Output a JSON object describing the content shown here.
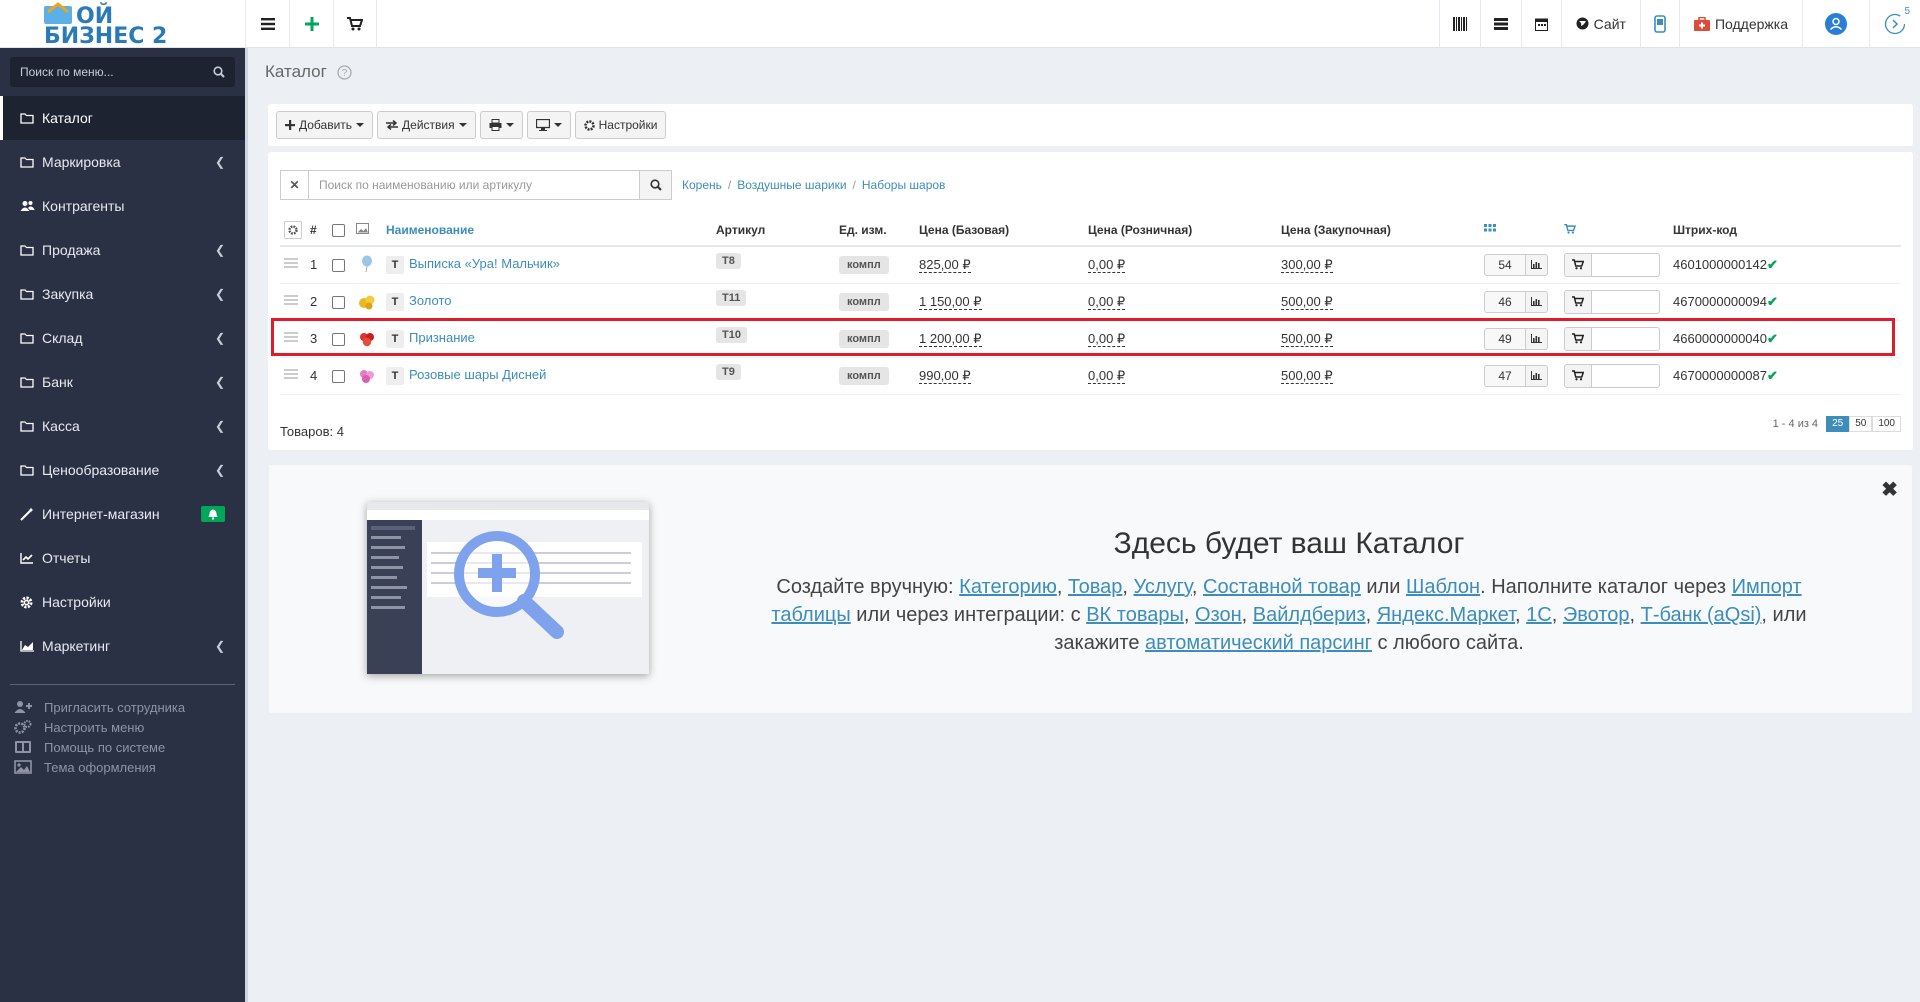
{
  "app": {
    "logo_line1": "МОЙ",
    "logo_line2": "БИЗНЕС 2"
  },
  "topbar": {
    "site_label": "Сайт",
    "support_label": "Поддержка",
    "notif_count": "5"
  },
  "sidebar": {
    "search_placeholder": "Поиск по меню...",
    "items": [
      {
        "label": "Каталог",
        "icon": "folder-icon"
      },
      {
        "label": "Маркировка",
        "icon": "folder-icon"
      },
      {
        "label": "Контрагенты",
        "icon": "users-icon"
      },
      {
        "label": "Продажа",
        "icon": "folder-icon"
      },
      {
        "label": "Закупка",
        "icon": "folder-icon"
      },
      {
        "label": "Склад",
        "icon": "folder-icon"
      },
      {
        "label": "Банк",
        "icon": "folder-icon"
      },
      {
        "label": "Касса",
        "icon": "folder-icon"
      },
      {
        "label": "Ценообразование",
        "icon": "folder-icon"
      },
      {
        "label": "Интернет-магазин",
        "icon": "magic-icon"
      },
      {
        "label": "Отчеты",
        "icon": "chart-icon"
      },
      {
        "label": "Настройки",
        "icon": "gear-icon"
      },
      {
        "label": "Маркетинг",
        "icon": "area-chart-icon"
      }
    ],
    "extras": [
      {
        "label": "Пригласить сотрудника"
      },
      {
        "label": "Настроить меню"
      },
      {
        "label": "Помощь по системе"
      },
      {
        "label": "Тема оформления"
      }
    ]
  },
  "page": {
    "title": "Каталог"
  },
  "toolbar": {
    "add_label": "Добавить",
    "actions_label": "Действия",
    "settings_label": "Настройки"
  },
  "catalog": {
    "search_placeholder": "Поиск по наименованию или артикулу",
    "breadcrumb": [
      "Корень",
      "Воздушные шарики",
      "Наборы шаров"
    ],
    "columns": {
      "num": "#",
      "name": "Наименование",
      "article": "Артикул",
      "unit": "Ед. изм.",
      "price_base": "Цена (Базовая)",
      "price_retail": "Цена (Розничная)",
      "price_purchase": "Цена (Закупочная)",
      "barcode": "Штрих-код"
    },
    "rows": [
      {
        "num": "1",
        "type": "Т",
        "name": "Выписка «Ура! Мальчик»",
        "article": "Т8",
        "unit": "компл",
        "price_base": "825,00 ₽",
        "price_retail": "0,00 ₽",
        "price_purchase": "300,00 ₽",
        "stock": "54",
        "barcode": "4601000000142"
      },
      {
        "num": "2",
        "type": "Т",
        "name": "Золото",
        "article": "Т11",
        "unit": "компл",
        "price_base": "1 150,00 ₽",
        "price_retail": "0,00 ₽",
        "price_purchase": "500,00 ₽",
        "stock": "46",
        "barcode": "4670000000094"
      },
      {
        "num": "3",
        "type": "Т",
        "name": "Признание",
        "article": "Т10",
        "unit": "компл",
        "price_base": "1 200,00 ₽",
        "price_retail": "0,00 ₽",
        "price_purchase": "500,00 ₽",
        "stock": "49",
        "barcode": "4660000000040"
      },
      {
        "num": "4",
        "type": "Т",
        "name": "Розовые шары Дисней",
        "article": "Т9",
        "unit": "компл",
        "price_base": "990,00 ₽",
        "price_retail": "0,00 ₽",
        "price_purchase": "500,00 ₽",
        "stock": "47",
        "barcode": "4670000000087"
      }
    ],
    "total_label": "Товаров: 4",
    "range_label": "1 - 4 из 4",
    "page_sizes": [
      "25",
      "50",
      "100"
    ],
    "active_page_size": "25"
  },
  "info": {
    "title": "Здесь будет ваш Каталог",
    "t1": "Создайте вручную: ",
    "l_category": "Категорию",
    "sep1": ", ",
    "l_product": "Товар",
    "sep2": ", ",
    "l_service": "Услугу",
    "sep3": ", ",
    "l_composite": "Составной товар",
    "t_or": " или ",
    "l_template": "Шаблон",
    "t2": ". Наполните каталог через ",
    "l_import": "Импорт таблицы",
    "t3": " или через интеграции: с ",
    "l_vk": "ВК товары",
    "sep4": ", ",
    "l_ozon": "Озон",
    "sep5": ", ",
    "l_wb": "Вайлдбериз",
    "sep6": ", ",
    "l_ym": "Яндекс.Маркет",
    "sep7": ", ",
    "l_1c": "1С",
    "sep8": ", ",
    "l_evotor": "Эвотор",
    "sep9": ", ",
    "l_tbank": "Т-банк (aQsi)",
    "t4": ", или закажите ",
    "l_parsing": "автоматический парсинг",
    "t5": " с любого сайта."
  },
  "colors": {
    "accent": "#3c8dbc",
    "sidebar_bg": "#2b3144",
    "highlight": "#dd1e2a",
    "success": "#00a65a"
  }
}
